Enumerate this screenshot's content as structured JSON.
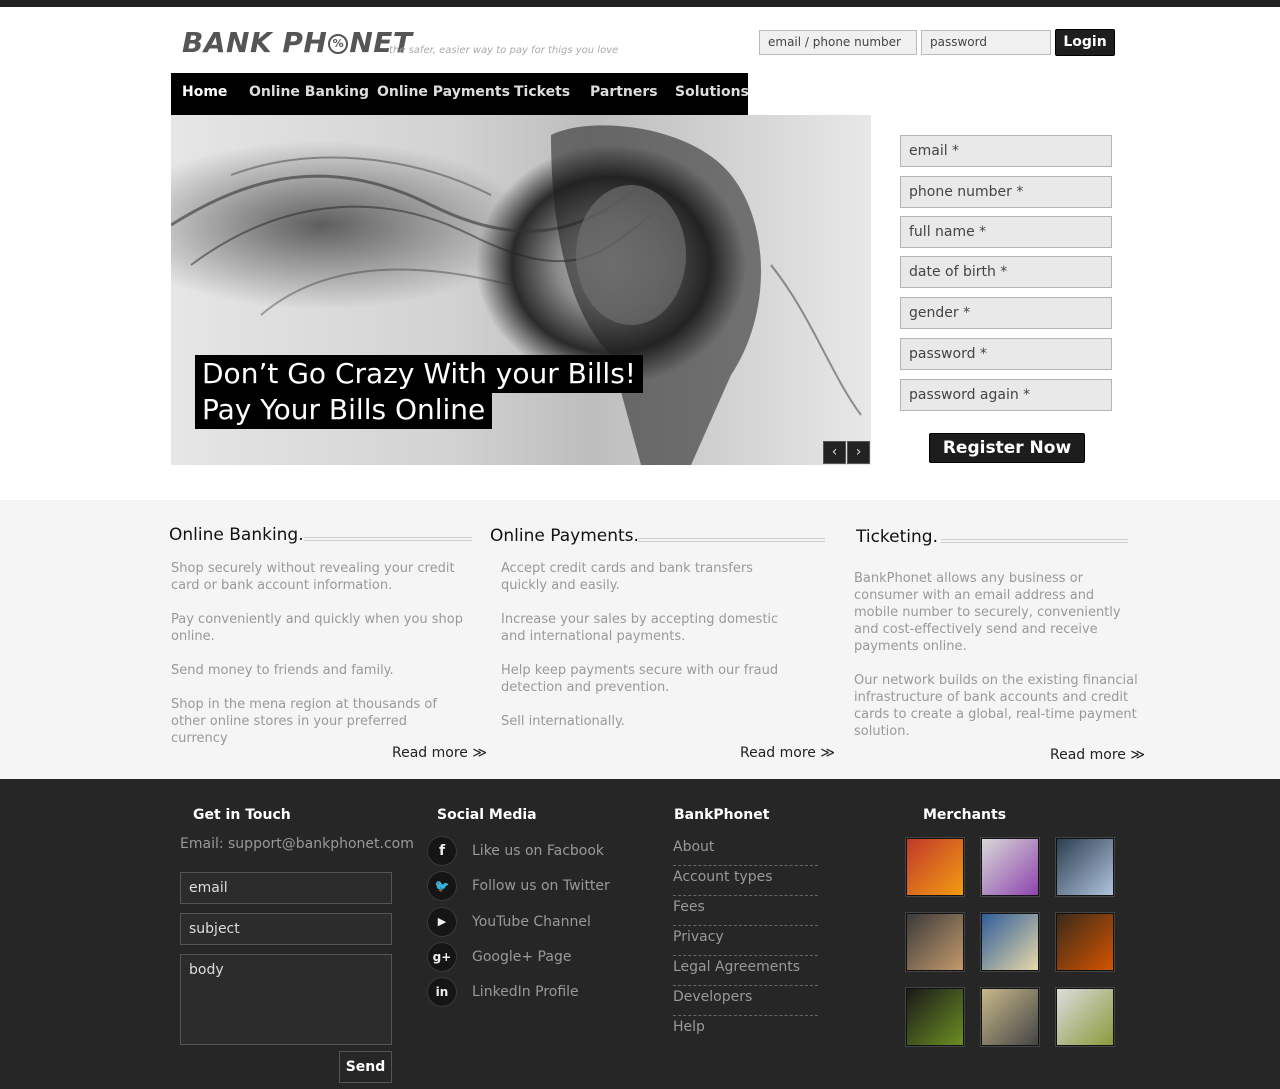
{
  "header": {
    "logo_text_1": "BANK PH",
    "logo_pct": "%",
    "logo_text_2": "NET",
    "tagline": "the safer, easier way to pay for thigs you love",
    "login_email_placeholder": "email / phone number",
    "login_password_placeholder": "password",
    "login_button": "Login"
  },
  "nav": {
    "items": [
      {
        "label": "Home",
        "active": true
      },
      {
        "label": "Online Banking"
      },
      {
        "label": "Online Payments"
      },
      {
        "label": "Tickets"
      },
      {
        "label": "Partners"
      },
      {
        "label": "Solutions"
      }
    ]
  },
  "hero": {
    "caption_line1": "Don’t Go Crazy With your Bills!",
    "caption_line2": "Pay Your Bills Online",
    "prev": "‹",
    "next": "›"
  },
  "register": {
    "fields": [
      "email *",
      "phone number *",
      "full name *",
      "date of birth *",
      "gender *",
      "password *",
      "password again *"
    ],
    "button": "Register Now"
  },
  "features": {
    "banking": {
      "title": "Online Banking.",
      "paragraphs": [
        "Shop securely without revealing your credit card or bank account information.",
        "Pay conveniently and quickly when you shop online.",
        "Send money to friends and family.",
        "Shop in the mena region  at thousands of other online stores in your preferred currency"
      ],
      "read_more": "Read more ≫"
    },
    "payments": {
      "title": "Online Payments.",
      "paragraphs": [
        "Accept credit cards and bank transfers quickly and easily.",
        "Increase your sales by accepting domestic and international payments.",
        "Help keep payments secure with our fraud detection and prevention.",
        "Sell internationally."
      ],
      "read_more": "Read more ≫"
    },
    "ticketing": {
      "title": "Ticketing.",
      "paragraphs": [
        "BankPhonet allows any business or consumer with an email address and mobile number to securely, conveniently and cost-effectively send and receive payments online.",
        "Our network builds on the existing financial infrastructure of bank accounts and credit cards to create a global, real-time payment solution."
      ],
      "read_more": "Read more ≫"
    }
  },
  "footer": {
    "contact": {
      "title": "Get in Touch",
      "email_line": "Email: support@bankphonet.com",
      "email_placeholder": "email",
      "subject_placeholder": "subject",
      "body_placeholder": "body",
      "send": "Send"
    },
    "social": {
      "title": "Social Media",
      "items": [
        {
          "icon": "facebook-icon",
          "glyph": "f",
          "label": "Like us on Facbook"
        },
        {
          "icon": "twitter-icon",
          "glyph": "🐦",
          "label": "Follow us on Twitter"
        },
        {
          "icon": "youtube-icon",
          "glyph": "▶",
          "label": "YouTube Channel"
        },
        {
          "icon": "googleplus-icon",
          "glyph": "g+",
          "label": "Google+ Page"
        },
        {
          "icon": "linkedin-icon",
          "glyph": "in",
          "label": "LinkedIn Profile"
        }
      ]
    },
    "company": {
      "title": "BankPhonet",
      "links": [
        "About",
        "Account types",
        "Fees",
        "Privacy",
        "Legal Agreements",
        "Developers",
        "Help"
      ]
    },
    "merchants": {
      "title": "Merchants",
      "thumbs": [
        {
          "colors": [
            "#c0392b",
            "#f39c12"
          ]
        },
        {
          "colors": [
            "#d8d8d8",
            "#8e44ad"
          ]
        },
        {
          "colors": [
            "#2c3e50",
            "#b0c4de"
          ]
        },
        {
          "colors": [
            "#3a3a3a",
            "#c49a6c"
          ]
        },
        {
          "colors": [
            "#2f5d9a",
            "#e8d9a8"
          ]
        },
        {
          "colors": [
            "#3b2a1a",
            "#d35400"
          ]
        },
        {
          "colors": [
            "#1a1a1a",
            "#6b8e23"
          ]
        },
        {
          "colors": [
            "#c8b88a",
            "#444444"
          ]
        },
        {
          "colors": [
            "#dcdcdc",
            "#8a9a3c"
          ]
        }
      ]
    }
  }
}
